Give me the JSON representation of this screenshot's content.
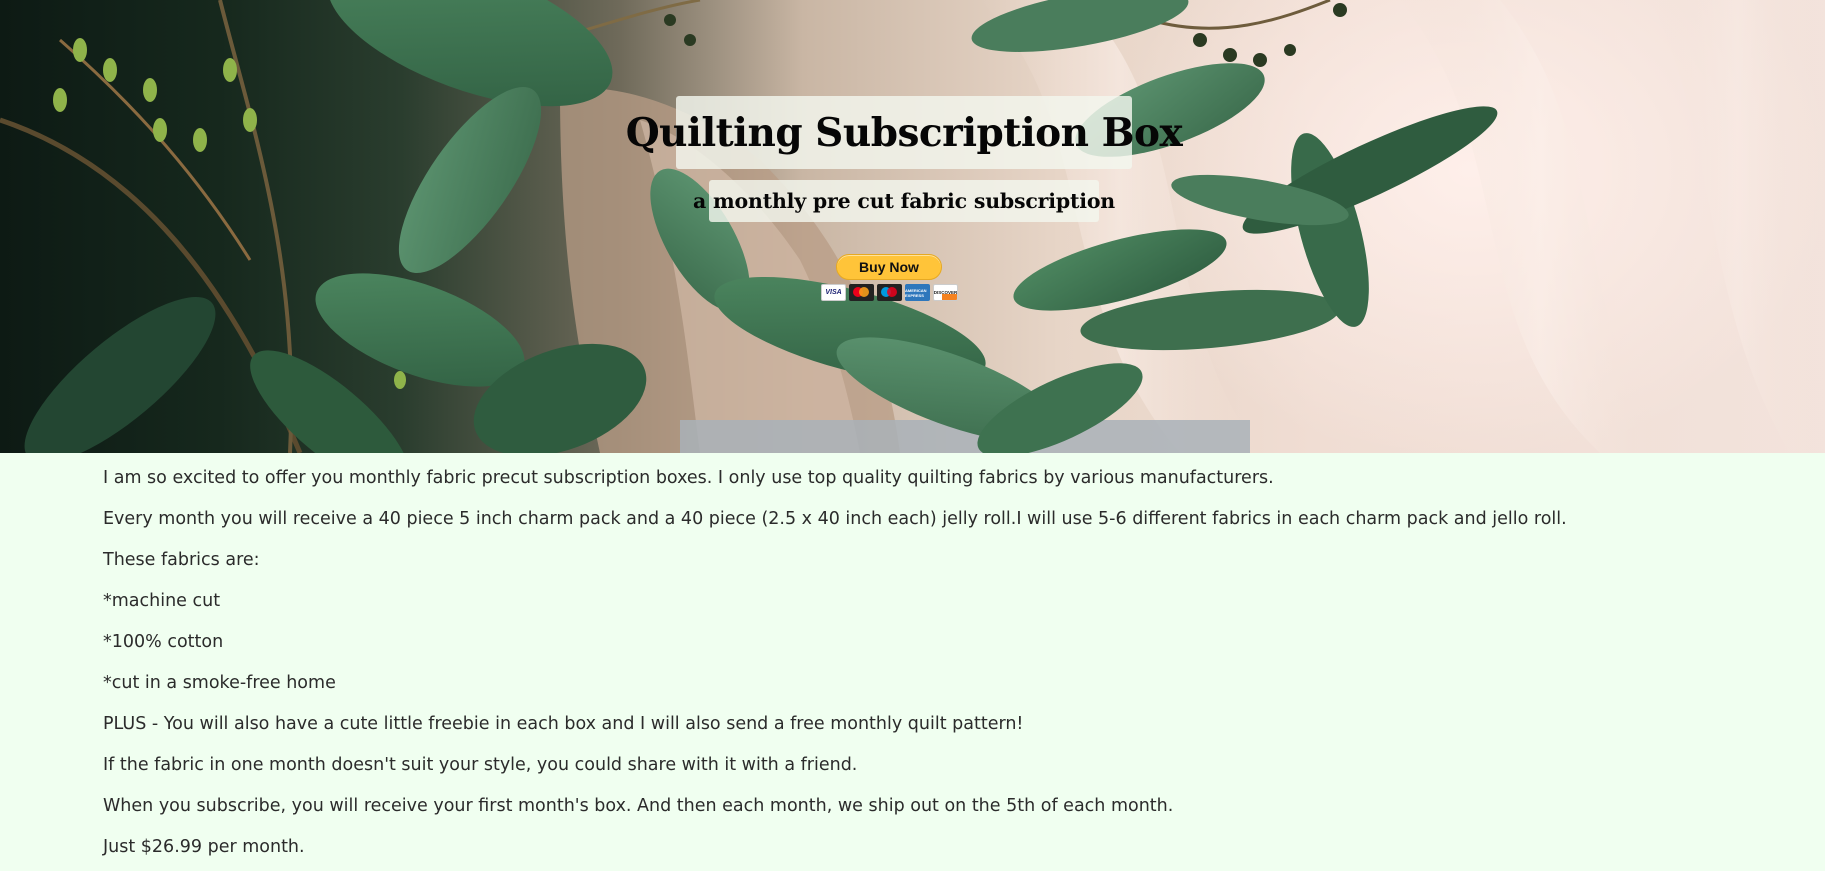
{
  "hero": {
    "title": "Quilting Subscription Box",
    "subtitle": "a monthly pre cut fabric subscription",
    "buy_button_label": "Buy Now",
    "payment_cards": [
      "VISA",
      "mastercard",
      "maestro",
      "AMERICAN EXPRESS",
      "DISCOVER"
    ],
    "background_image": "eucalyptus-leaves-on-blush-fabric"
  },
  "content": {
    "paragraphs": [
      "I am so excited to offer you monthly fabric precut subscription boxes. I only use top quality quilting fabrics by various manufacturers.",
      "Every month you will receive a 40 piece 5 inch charm pack and a 40 piece (2.5 x 40 inch each) jelly roll.I will use 5-6 different fabrics in each charm pack and jello roll.",
      "These fabrics are:",
      "*machine cut",
      "*100% cotton",
      "*cut in a smoke-free home",
      "PLUS - You will also have a cute little freebie in each box and I will also send a free monthly quilt pattern!",
      "If the fabric in one month doesn't suit your style, you could share with it with a friend.",
      "When you subscribe, you will receive your first month's box. And then each month, we ship out on the 5th of each month.",
      "Just $26.99 per month."
    ]
  },
  "colors": {
    "page_background": "#f0fff0",
    "buy_button": "#ffc439",
    "text": "#2b2b2b"
  }
}
